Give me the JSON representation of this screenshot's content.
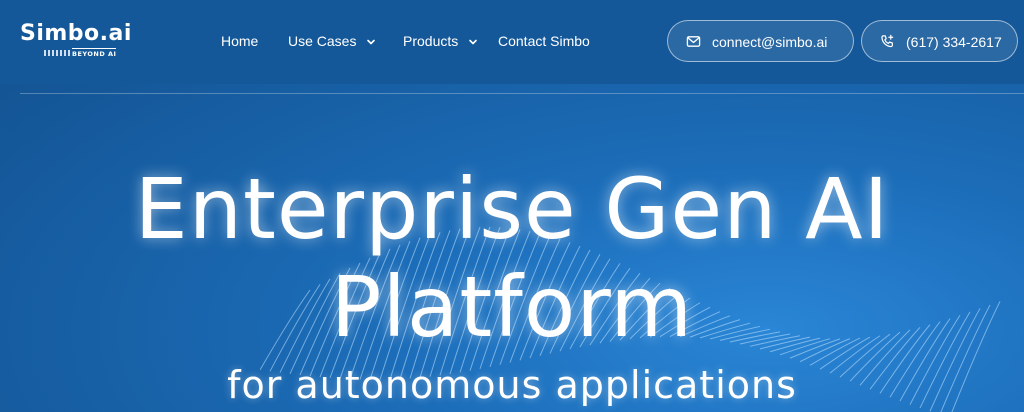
{
  "brand": {
    "name": "Simbo.ai",
    "tagline": "BEYOND AI"
  },
  "nav": {
    "items": [
      {
        "label": "Home",
        "has_dropdown": false
      },
      {
        "label": "Use Cases",
        "has_dropdown": true
      },
      {
        "label": "Products",
        "has_dropdown": true
      },
      {
        "label": "Contact Simbo",
        "has_dropdown": false
      }
    ]
  },
  "contact": {
    "email": "connect@simbo.ai",
    "email_icon": "mail-icon",
    "phone": "(617) 334-2617",
    "phone_icon": "phone-icon"
  },
  "hero": {
    "title_line1": "Enterprise Gen AI",
    "title_line2": "Platform",
    "subtitle": "for autonomous applications"
  },
  "colors": {
    "header_bg": "#14589a",
    "hero_bg": "#1c6db9",
    "text": "#ffffff"
  }
}
